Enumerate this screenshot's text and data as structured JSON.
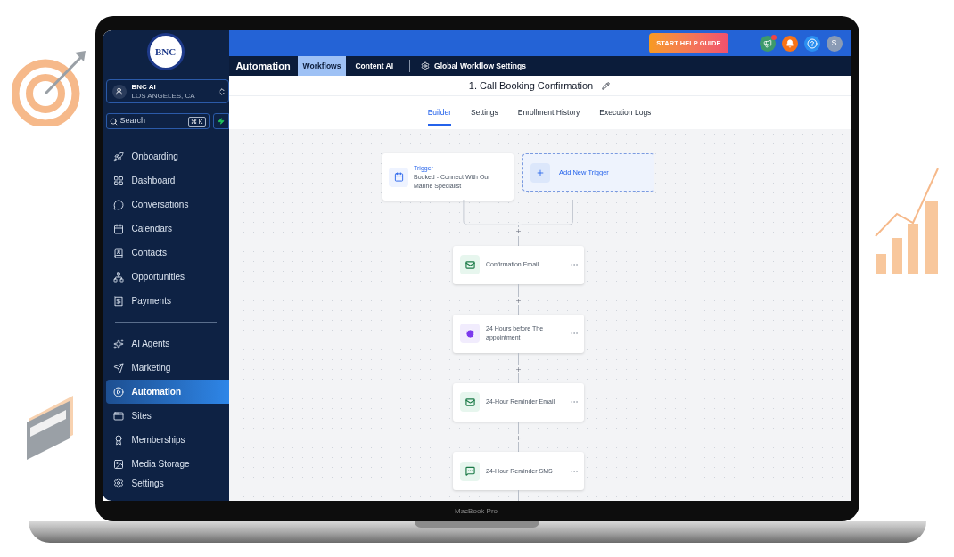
{
  "sidebar": {
    "logo_text": "BNC",
    "account": {
      "name": "BNC AI",
      "location": "LOS ANGELES, CA"
    },
    "search": {
      "placeholder": "Search",
      "shortcut": "⌘ K"
    },
    "sections": [
      [
        {
          "label": "Onboarding",
          "selected": false
        },
        {
          "label": "Dashboard",
          "selected": false
        },
        {
          "label": "Conversations",
          "selected": false
        },
        {
          "label": "Calendars",
          "selected": false
        },
        {
          "label": "Contacts",
          "selected": false
        },
        {
          "label": "Opportunities",
          "selected": false
        },
        {
          "label": "Payments",
          "selected": false
        }
      ],
      [
        {
          "label": "AI Agents",
          "selected": false
        },
        {
          "label": "Marketing",
          "selected": false
        },
        {
          "label": "Automation",
          "selected": true
        },
        {
          "label": "Sites",
          "selected": false
        },
        {
          "label": "Memberships",
          "selected": false
        },
        {
          "label": "Media Storage",
          "selected": false
        }
      ]
    ],
    "footer_item": "Settings"
  },
  "header": {
    "help_button": "START HELP GUIDE",
    "avatar": "S"
  },
  "nav": {
    "title": "Automation",
    "tabs": [
      {
        "label": "Workflows",
        "selected": true
      },
      {
        "label": "Content AI",
        "selected": false
      }
    ],
    "settings_link": "Global Workflow Settings"
  },
  "workflow": {
    "title": "1. Call Booking Confirmation",
    "tabs": [
      {
        "label": "Builder",
        "selected": true
      },
      {
        "label": "Settings",
        "selected": false
      },
      {
        "label": "Enrollment History",
        "selected": false
      },
      {
        "label": "Execution Logs",
        "selected": false
      }
    ]
  },
  "canvas": {
    "trigger": {
      "label": "Trigger",
      "text": "Booked - Connect With Our Marine Specialist"
    },
    "add_trigger": "Add New Trigger",
    "steps": [
      {
        "kind": "email",
        "label": "Confirmation Email"
      },
      {
        "kind": "wait",
        "label": "24 Hours before The appointment"
      },
      {
        "kind": "email",
        "label": "24-Hour Reminder Email"
      },
      {
        "kind": "sms",
        "label": "24-Hour Reminder SMS"
      }
    ]
  },
  "laptop_label": "MacBook Pro"
}
